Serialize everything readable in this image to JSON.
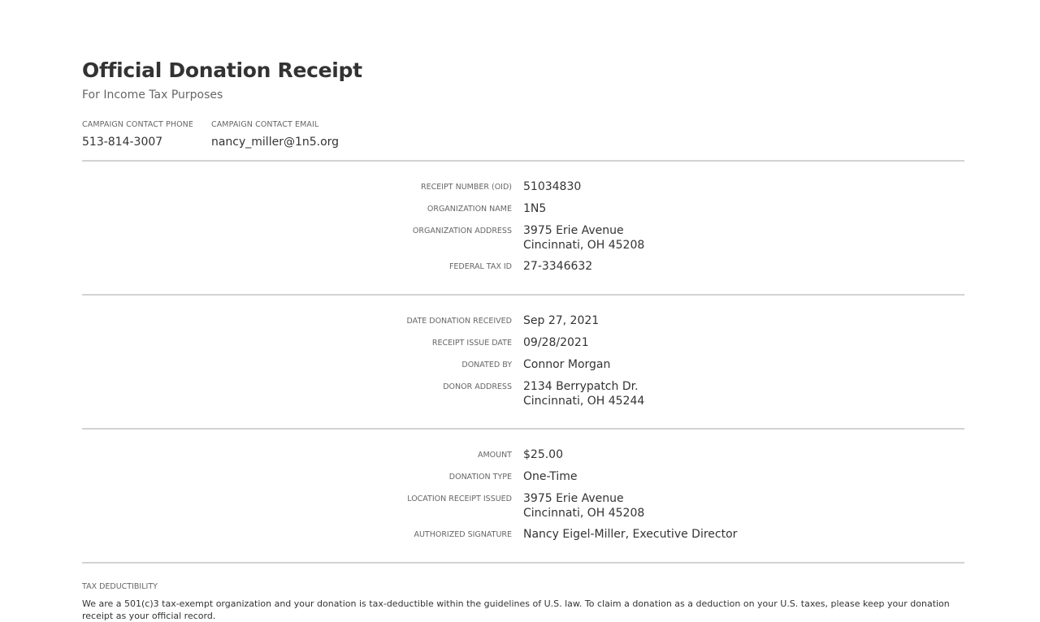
{
  "header": {
    "title": "Official Donation Receipt",
    "subtitle": "For Income Tax Purposes"
  },
  "contacts": [
    {
      "label": "CAMPAIGN CONTACT PHONE",
      "value": "513-814-3007"
    },
    {
      "label": "CAMPAIGN CONTACT EMAIL",
      "value": "nancy_miller@1n5.org"
    }
  ],
  "organization": {
    "receipt_number": {
      "label": "RECEIPT NUMBER (OID)",
      "value": "51034830"
    },
    "org_name": {
      "label": "ORGANIZATION NAME",
      "value": "1N5"
    },
    "org_address": {
      "label": "ORGANIZATION ADDRESS",
      "line1": "3975 Erie Avenue",
      "line2": "Cincinnati, OH 45208"
    },
    "tax_id": {
      "label": "FEDERAL TAX ID",
      "value": "27-3346632"
    }
  },
  "donation": {
    "date_received": {
      "label": "DATE DONATION RECEIVED",
      "value": "Sep 27, 2021"
    },
    "issue_date": {
      "label": "RECEIPT ISSUE DATE",
      "value": "09/28/2021"
    },
    "donated_by": {
      "label": "DONATED BY",
      "value": "Connor Morgan"
    },
    "donor_address": {
      "label": "DONOR ADDRESS",
      "line1": "2134 Berrypatch Dr.",
      "line2": "Cincinnati, OH 45244"
    }
  },
  "payment": {
    "amount": {
      "label": "AMOUNT",
      "value": "$25.00"
    },
    "donation_type": {
      "label": "DONATION TYPE",
      "value": "One-Time"
    },
    "location_issued": {
      "label": "LOCATION RECEIPT ISSUED",
      "line1": "3975 Erie Avenue",
      "line2": "Cincinnati, OH 45208"
    },
    "signature": {
      "label": "AUTHORIZED SIGNATURE",
      "value": "Nancy Eigel-Miller, Executive Director"
    }
  },
  "tax": {
    "label": "TAX DEDUCTIBILITY",
    "text": "We are a 501(c)3 tax-exempt organization and your donation is tax-deductible within the guidelines of U.S. law. To claim a donation as a deduction on your U.S. taxes, please keep your donation receipt as your official record."
  }
}
